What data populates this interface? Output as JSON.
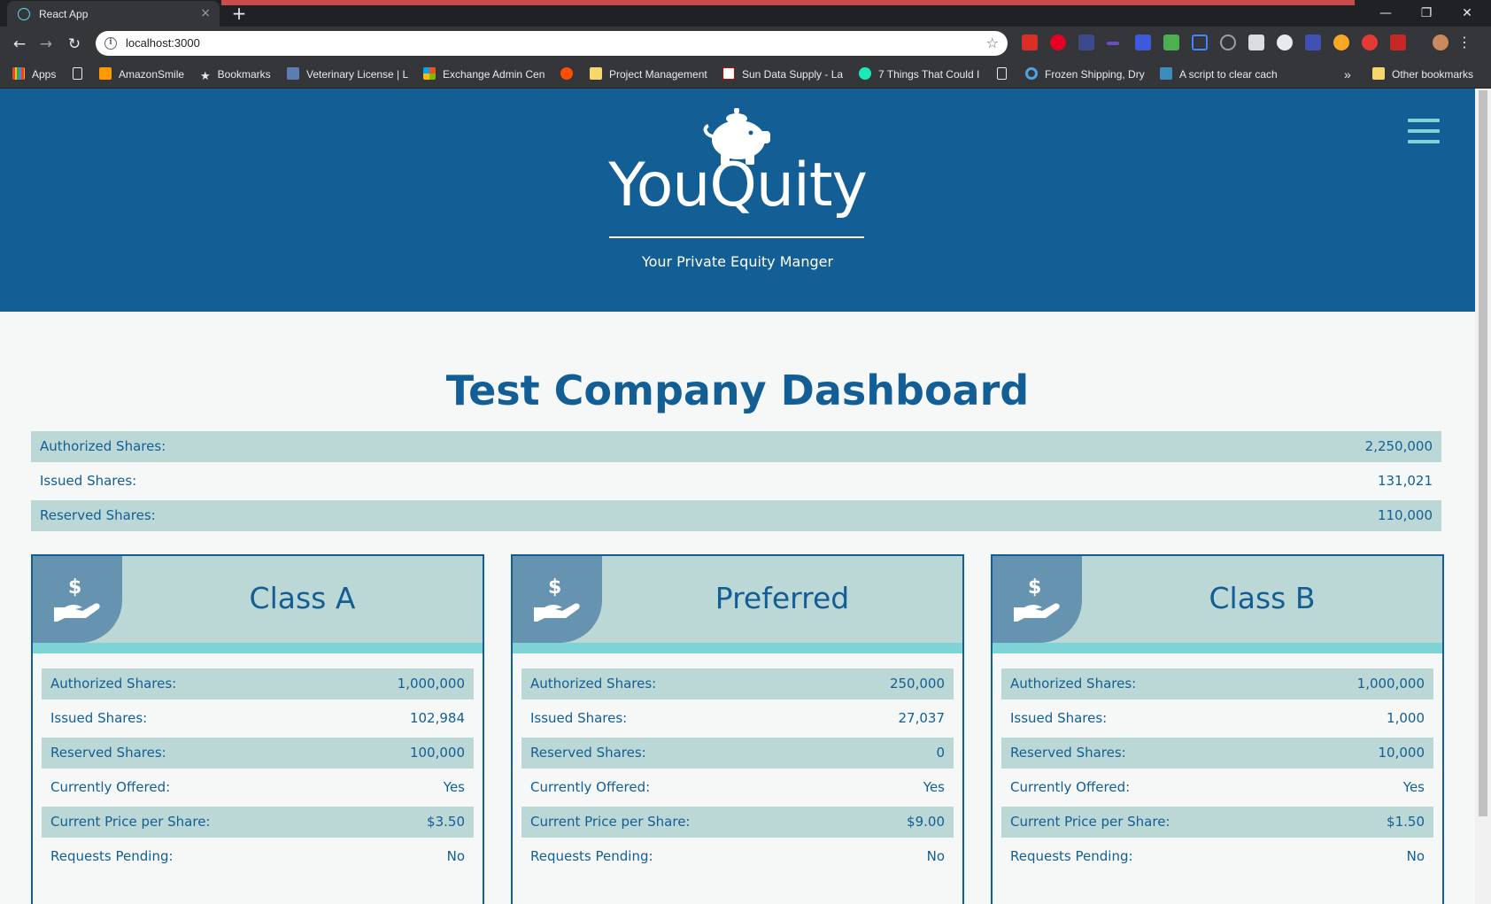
{
  "browser": {
    "tab_title": "React App",
    "tab_close": "×",
    "new_tab": "+",
    "url": "localhost:3000",
    "window_controls": {
      "minimize": "—",
      "restore": "❐",
      "close": "✕"
    },
    "bookmarks": [
      {
        "label": "Apps",
        "icon": "apps-grid-icon"
      },
      {
        "label": "",
        "icon": "page-icon"
      },
      {
        "label": "AmazonSmile",
        "icon": "amazon-icon"
      },
      {
        "label": "Bookmarks",
        "icon": "star-icon"
      },
      {
        "label": "Veterinary License | L",
        "icon": "vet-icon"
      },
      {
        "label": "Exchange Admin Cen",
        "icon": "microsoft-icon"
      },
      {
        "label": "",
        "icon": "ars-icon"
      },
      {
        "label": "Project Management",
        "icon": "folder-icon"
      },
      {
        "label": "Sun Data Supply - La",
        "icon": "sun-data-icon"
      },
      {
        "label": "7 Things That Could I",
        "icon": "arrow-circle-icon"
      },
      {
        "label": "",
        "icon": "page-icon"
      },
      {
        "label": "Frozen Shipping, Dry",
        "icon": "circle-icon"
      },
      {
        "label": "A script to clear cach",
        "icon": "404-icon"
      },
      {
        "label": "»",
        "icon": ""
      },
      {
        "label": "Other bookmarks",
        "icon": "folder-icon"
      }
    ]
  },
  "header": {
    "brand": "YouQuity",
    "tagline": "Your Private Equity Manger"
  },
  "dashboard": {
    "title": "Test Company Dashboard",
    "summary": [
      {
        "label": "Authorized Shares:",
        "value": "2,250,000"
      },
      {
        "label": "Issued Shares:",
        "value": "131,021"
      },
      {
        "label": "Reserved Shares:",
        "value": "110,000"
      }
    ],
    "classes": [
      {
        "name": "Class A",
        "rows": [
          {
            "label": "Authorized Shares:",
            "value": "1,000,000"
          },
          {
            "label": "Issued Shares:",
            "value": "102,984"
          },
          {
            "label": "Reserved Shares:",
            "value": "100,000"
          },
          {
            "label": "Currently Offered:",
            "value": "Yes"
          },
          {
            "label": "Current Price per Share:",
            "value": "$3.50"
          },
          {
            "label": "Requests Pending:",
            "value": "No"
          }
        ]
      },
      {
        "name": "Preferred",
        "rows": [
          {
            "label": "Authorized Shares:",
            "value": "250,000"
          },
          {
            "label": "Issued Shares:",
            "value": "27,037"
          },
          {
            "label": "Reserved Shares:",
            "value": "0"
          },
          {
            "label": "Currently Offered:",
            "value": "Yes"
          },
          {
            "label": "Current Price per Share:",
            "value": "$9.00"
          },
          {
            "label": "Requests Pending:",
            "value": "No"
          }
        ]
      },
      {
        "name": "Class B",
        "rows": [
          {
            "label": "Authorized Shares:",
            "value": "1,000,000"
          },
          {
            "label": "Issued Shares:",
            "value": "1,000"
          },
          {
            "label": "Reserved Shares:",
            "value": "10,000"
          },
          {
            "label": "Currently Offered:",
            "value": "Yes"
          },
          {
            "label": "Current Price per Share:",
            "value": "$1.50"
          },
          {
            "label": "Requests Pending:",
            "value": "No"
          }
        ]
      }
    ]
  },
  "colors": {
    "primary": "#125e95",
    "accent": "#7fd3d6",
    "row_shade": "#bcd8d6",
    "icon_box": "#6693b0",
    "page_bg": "#f6f8f8"
  }
}
